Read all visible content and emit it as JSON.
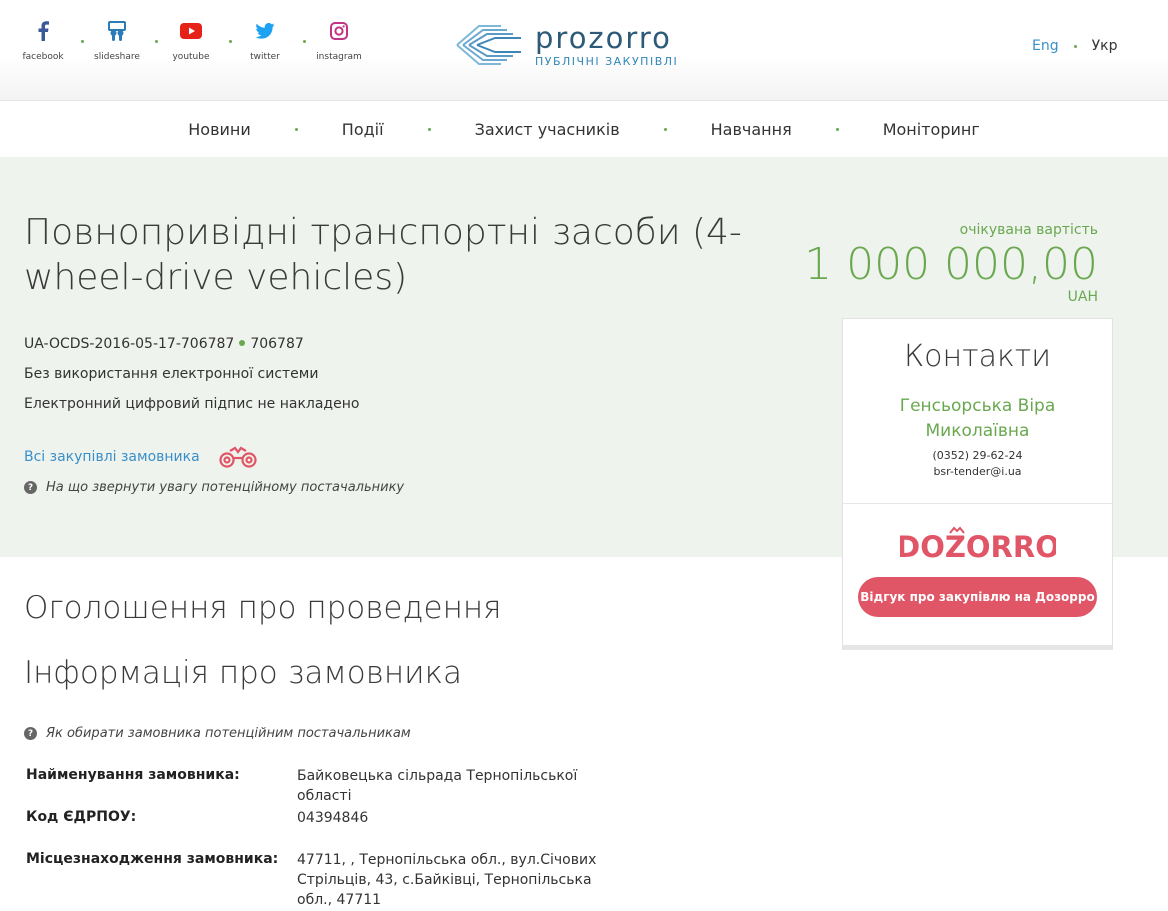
{
  "social": [
    {
      "label": "facebook",
      "icon": "facebook-icon"
    },
    {
      "label": "slideshare",
      "icon": "slideshare-icon"
    },
    {
      "label": "youtube",
      "icon": "youtube-icon"
    },
    {
      "label": "twitter",
      "icon": "twitter-icon"
    },
    {
      "label": "instagram",
      "icon": "instagram-icon"
    }
  ],
  "logo": {
    "name": "prozorro",
    "subtitle": "ПУБЛІЧНІ ЗАКУПІВЛІ"
  },
  "lang": {
    "en": "Eng",
    "uk": "Укр"
  },
  "nav": [
    "Новини",
    "Події",
    "Захист учасників",
    "Навчання",
    "Моніторинг"
  ],
  "tender": {
    "title": "Повнопривідні транспортні засоби (4-wheel-drive vehicles)",
    "id": "UA-OCDS-2016-05-17-706787",
    "short_id": "706787",
    "procedure": "Без використання електронної системи",
    "signature": "Електронний цифровий підпис не накладено",
    "all_purchases": "Всі закупівлі замовника",
    "hint": "На що звернути увагу потенційному постачальнику"
  },
  "expected": {
    "label": "очікувана вартість",
    "amount": "1 000 000,00",
    "currency": "UAH"
  },
  "contacts": {
    "title": "Контакти",
    "name_line1": "Генсьорська Віра",
    "name_line2": "Миколаївна",
    "phone": "(0352) 29-62-24",
    "email": "bsr-tender@i.ua",
    "dozorro_logo": "DOZORRO",
    "dozorro_button": "Відгук про закупівлю на Дозорро"
  },
  "sections": {
    "announcement": "Оголошення про проведення",
    "customer_info": "Інформація про замовника",
    "customer_hint": "Як обирати замовника потенційним постачальникам"
  },
  "customer": {
    "name_label": "Найменування замовника:",
    "name_value": "Байковецька сільрада Тернопільської області",
    "edrpou_label": "Код ЄДРПОУ:",
    "edrpou_value": "04394846",
    "location_label": "Місцезнаходження замовника:",
    "location_value": "47711, , Тернопільська обл., вул.Січових Стрільців, 43, с.Байківці, Тернопільська обл., 47711"
  },
  "colors": {
    "accent_green": "#6aa84f",
    "link_blue": "#3a8fc8",
    "dozorro_red": "#e05667",
    "hero_bg": "#eff3ee"
  }
}
